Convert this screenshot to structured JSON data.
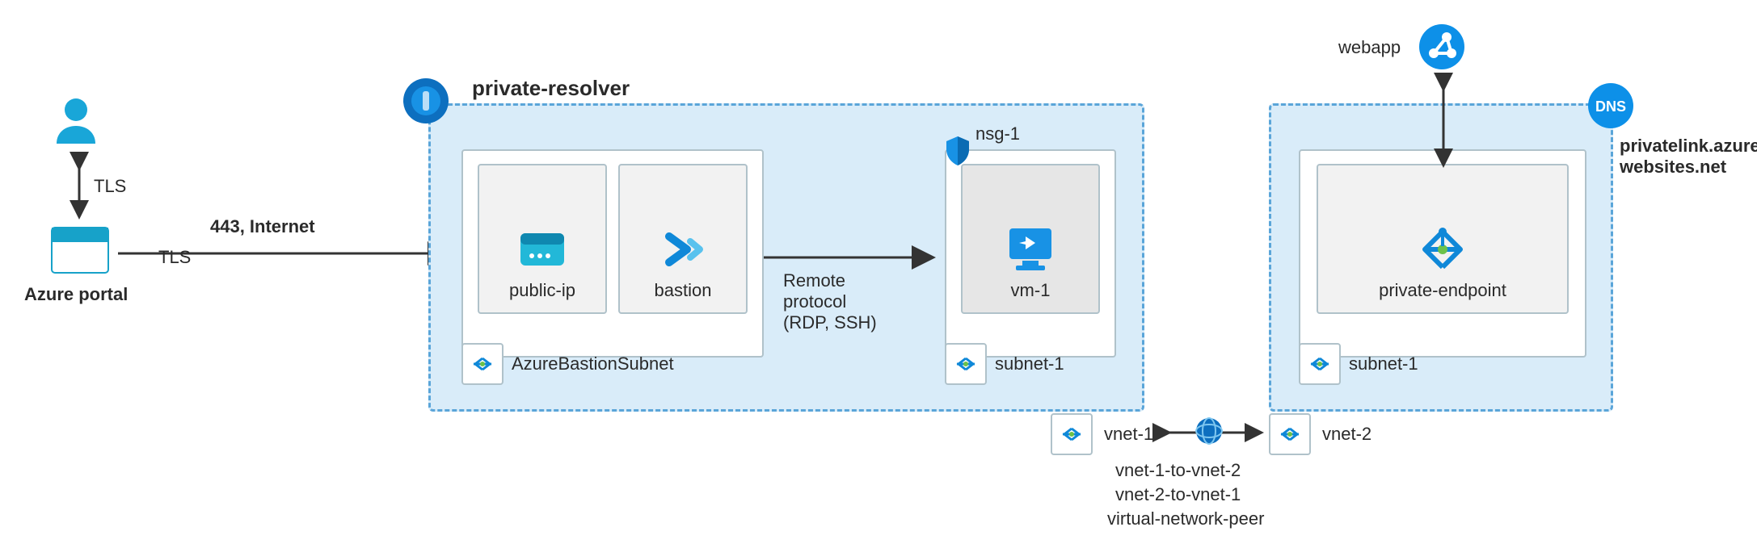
{
  "user_label": "TLS",
  "portal": {
    "title": "Azure portal",
    "conn_label": "TLS",
    "conn_bold": "443, Internet"
  },
  "vnet1": {
    "title": "private-resolver",
    "name": "vnet-1",
    "bastion_subnet": {
      "name": "AzureBastionSubnet",
      "public_ip": "public-ip",
      "bastion": "bastion"
    },
    "remote_label": "Remote\nprotocol\n(RDP, SSH)",
    "subnet1": {
      "name": "subnet-1",
      "nsg": "nsg-1",
      "vm": "vm-1"
    }
  },
  "peering": {
    "a": "vnet-1-to-vnet-2",
    "b": "vnet-2-to-vnet-1",
    "c": "virtual-network-peer"
  },
  "vnet2": {
    "name": "vnet-2",
    "subnet1": {
      "name": "subnet-1",
      "pe": "private-endpoint"
    },
    "dns_zone": "privatelink.azure\nwebsites.net",
    "webapp": "webapp"
  }
}
